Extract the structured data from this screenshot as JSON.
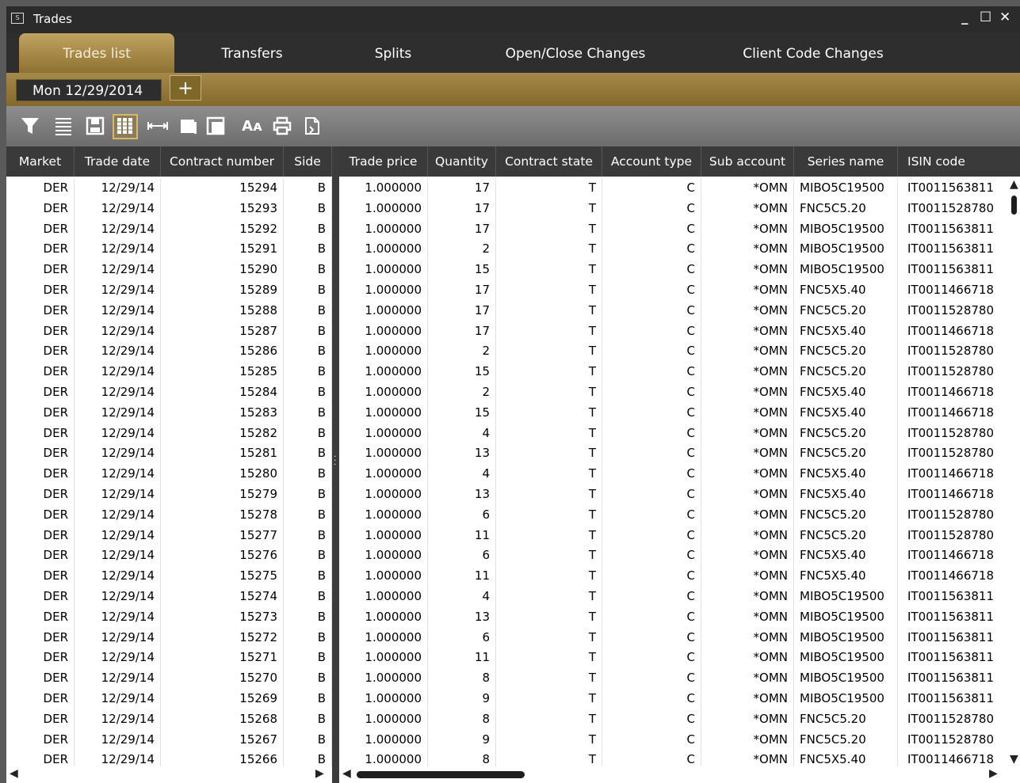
{
  "window": {
    "title": "Trades",
    "minimize": "_",
    "maximize": "☐",
    "close": "✕",
    "icon_label": "S"
  },
  "tabs": [
    {
      "label": "Trades list",
      "active": true
    },
    {
      "label": "Transfers",
      "active": false
    },
    {
      "label": "Splits",
      "active": false
    },
    {
      "label": "Open/Close Changes",
      "active": false
    },
    {
      "label": "Client Code Changes",
      "active": false
    }
  ],
  "date_selector": {
    "value": "Mon 12/29/2014",
    "add_label": "+"
  },
  "toolbar_icons": [
    "filter-icon",
    "lines-icon",
    "save-icon",
    "columns-icon",
    "fit-width-icon",
    "copy-icon",
    "paste-icon",
    "font-size-icon",
    "print-icon",
    "export-icon"
  ],
  "colors": {
    "accent": "#a4894b",
    "active_tab": "#c2a461",
    "header_bg": "#3a3a3a",
    "toolbar_bg": "#7d7d7d"
  },
  "left_columns": [
    "Market",
    "Trade date",
    "Contract number",
    "Side"
  ],
  "right_columns": [
    "Trade price",
    "Quantity",
    "Contract state",
    "Account type",
    "Sub account",
    "Series name",
    "ISIN code"
  ],
  "rows": [
    [
      "DER",
      "12/29/14",
      "15294",
      "B",
      "1.000000",
      "17",
      "T",
      "C",
      "*OMN",
      "MIBO5C19500",
      "IT0011563811"
    ],
    [
      "DER",
      "12/29/14",
      "15293",
      "B",
      "1.000000",
      "17",
      "T",
      "C",
      "*OMN",
      "FNC5C5.20",
      "IT0011528780"
    ],
    [
      "DER",
      "12/29/14",
      "15292",
      "B",
      "1.000000",
      "17",
      "T",
      "C",
      "*OMN",
      "MIBO5C19500",
      "IT0011563811"
    ],
    [
      "DER",
      "12/29/14",
      "15291",
      "B",
      "1.000000",
      "2",
      "T",
      "C",
      "*OMN",
      "MIBO5C19500",
      "IT0011563811"
    ],
    [
      "DER",
      "12/29/14",
      "15290",
      "B",
      "1.000000",
      "15",
      "T",
      "C",
      "*OMN",
      "MIBO5C19500",
      "IT0011563811"
    ],
    [
      "DER",
      "12/29/14",
      "15289",
      "B",
      "1.000000",
      "17",
      "T",
      "C",
      "*OMN",
      "FNC5X5.40",
      "IT0011466718"
    ],
    [
      "DER",
      "12/29/14",
      "15288",
      "B",
      "1.000000",
      "17",
      "T",
      "C",
      "*OMN",
      "FNC5C5.20",
      "IT0011528780"
    ],
    [
      "DER",
      "12/29/14",
      "15287",
      "B",
      "1.000000",
      "17",
      "T",
      "C",
      "*OMN",
      "FNC5X5.40",
      "IT0011466718"
    ],
    [
      "DER",
      "12/29/14",
      "15286",
      "B",
      "1.000000",
      "2",
      "T",
      "C",
      "*OMN",
      "FNC5C5.20",
      "IT0011528780"
    ],
    [
      "DER",
      "12/29/14",
      "15285",
      "B",
      "1.000000",
      "15",
      "T",
      "C",
      "*OMN",
      "FNC5C5.20",
      "IT0011528780"
    ],
    [
      "DER",
      "12/29/14",
      "15284",
      "B",
      "1.000000",
      "2",
      "T",
      "C",
      "*OMN",
      "FNC5X5.40",
      "IT0011466718"
    ],
    [
      "DER",
      "12/29/14",
      "15283",
      "B",
      "1.000000",
      "15",
      "T",
      "C",
      "*OMN",
      "FNC5X5.40",
      "IT0011466718"
    ],
    [
      "DER",
      "12/29/14",
      "15282",
      "B",
      "1.000000",
      "4",
      "T",
      "C",
      "*OMN",
      "FNC5C5.20",
      "IT0011528780"
    ],
    [
      "DER",
      "12/29/14",
      "15281",
      "B",
      "1.000000",
      "13",
      "T",
      "C",
      "*OMN",
      "FNC5C5.20",
      "IT0011528780"
    ],
    [
      "DER",
      "12/29/14",
      "15280",
      "B",
      "1.000000",
      "4",
      "T",
      "C",
      "*OMN",
      "FNC5X5.40",
      "IT0011466718"
    ],
    [
      "DER",
      "12/29/14",
      "15279",
      "B",
      "1.000000",
      "13",
      "T",
      "C",
      "*OMN",
      "FNC5X5.40",
      "IT0011466718"
    ],
    [
      "DER",
      "12/29/14",
      "15278",
      "B",
      "1.000000",
      "6",
      "T",
      "C",
      "*OMN",
      "FNC5C5.20",
      "IT0011528780"
    ],
    [
      "DER",
      "12/29/14",
      "15277",
      "B",
      "1.000000",
      "11",
      "T",
      "C",
      "*OMN",
      "FNC5C5.20",
      "IT0011528780"
    ],
    [
      "DER",
      "12/29/14",
      "15276",
      "B",
      "1.000000",
      "6",
      "T",
      "C",
      "*OMN",
      "FNC5X5.40",
      "IT0011466718"
    ],
    [
      "DER",
      "12/29/14",
      "15275",
      "B",
      "1.000000",
      "11",
      "T",
      "C",
      "*OMN",
      "FNC5X5.40",
      "IT0011466718"
    ],
    [
      "DER",
      "12/29/14",
      "15274",
      "B",
      "1.000000",
      "4",
      "T",
      "C",
      "*OMN",
      "MIBO5C19500",
      "IT0011563811"
    ],
    [
      "DER",
      "12/29/14",
      "15273",
      "B",
      "1.000000",
      "13",
      "T",
      "C",
      "*OMN",
      "MIBO5C19500",
      "IT0011563811"
    ],
    [
      "DER",
      "12/29/14",
      "15272",
      "B",
      "1.000000",
      "6",
      "T",
      "C",
      "*OMN",
      "MIBO5C19500",
      "IT0011563811"
    ],
    [
      "DER",
      "12/29/14",
      "15271",
      "B",
      "1.000000",
      "11",
      "T",
      "C",
      "*OMN",
      "MIBO5C19500",
      "IT0011563811"
    ],
    [
      "DER",
      "12/29/14",
      "15270",
      "B",
      "1.000000",
      "8",
      "T",
      "C",
      "*OMN",
      "MIBO5C19500",
      "IT0011563811"
    ],
    [
      "DER",
      "12/29/14",
      "15269",
      "B",
      "1.000000",
      "9",
      "T",
      "C",
      "*OMN",
      "MIBO5C19500",
      "IT0011563811"
    ],
    [
      "DER",
      "12/29/14",
      "15268",
      "B",
      "1.000000",
      "8",
      "T",
      "C",
      "*OMN",
      "FNC5C5.20",
      "IT0011528780"
    ],
    [
      "DER",
      "12/29/14",
      "15267",
      "B",
      "1.000000",
      "9",
      "T",
      "C",
      "*OMN",
      "FNC5C5.20",
      "IT0011528780"
    ],
    [
      "DER",
      "12/29/14",
      "15266",
      "B",
      "1.000000",
      "8",
      "T",
      "C",
      "*OMN",
      "FNC5X5.40",
      "IT0011466718"
    ]
  ]
}
